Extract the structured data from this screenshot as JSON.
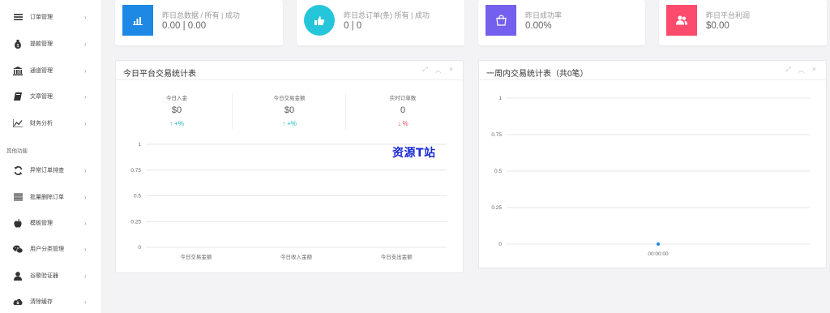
{
  "sidebar": {
    "items": [
      {
        "label": "订单管理",
        "icon": "list-icon"
      },
      {
        "label": "提款管理",
        "icon": "money-bag-icon"
      },
      {
        "label": "通道管理",
        "icon": "bank-icon"
      },
      {
        "label": "文章管理",
        "icon": "book-icon"
      },
      {
        "label": "财务分析",
        "icon": "line-chart-icon"
      }
    ],
    "section_label": "其他功能",
    "other_items": [
      {
        "label": "异常订单排查",
        "icon": "refresh-icon"
      },
      {
        "label": "批量删除订单",
        "icon": "list-icon"
      },
      {
        "label": "模板管理",
        "icon": "apple-icon"
      },
      {
        "label": "用户分类管理",
        "icon": "wechat-icon"
      },
      {
        "label": "谷歌验证器",
        "icon": "user-icon"
      },
      {
        "label": "清除缓存",
        "icon": "cloud-download-icon"
      }
    ],
    "chevron": "›"
  },
  "stats": [
    {
      "label": "昨日总数据 / 所有 | 成功",
      "value": "0.00 | 0.00",
      "color": "#1e88e5",
      "icon": "bar-chart-icon"
    },
    {
      "label": "昨日总订单(条) 所有 | 成功",
      "value": "0  | 0",
      "color": "#26c6da",
      "icon": "thumbs-up-icon"
    },
    {
      "label": "昨日成功率",
      "value": "0.00%",
      "color": "#7460ee",
      "icon": "shopping-bag-icon"
    },
    {
      "label": "昨日平台利润",
      "value": "$0.00",
      "color": "#fc4b6c",
      "icon": "users-icon"
    }
  ],
  "panel_today": {
    "title": "今日平台交易统计表",
    "metrics": [
      {
        "label": "今日入金",
        "value": "$0",
        "arrow": "↑",
        "change": "+%",
        "direction": "up"
      },
      {
        "label": "今日交易金额",
        "value": "$0",
        "arrow": "↑",
        "change": "+%",
        "direction": "up"
      },
      {
        "label": "实时订单数",
        "value": "0",
        "arrow": "↓",
        "change": "%",
        "direction": "down"
      }
    ],
    "watermark": "资源T站"
  },
  "panel_week": {
    "title": "一周内交易统计表（共0笔）"
  },
  "tools": {
    "expand": "⤢",
    "collapse": "︿",
    "close": "×"
  },
  "chart_data": [
    {
      "type": "bar",
      "categories": [
        "今日交易金额",
        "今日收入金额",
        "今日支出金额"
      ],
      "values": [
        0,
        0,
        0
      ],
      "ylim": [
        0,
        1
      ],
      "yticks": [
        "1",
        "0.75",
        "0.5",
        "0.25",
        "0"
      ],
      "grid": true
    },
    {
      "type": "line",
      "x": [
        "00:00:00"
      ],
      "values": [
        0
      ],
      "ylim": [
        0,
        1
      ],
      "yticks": [
        "1",
        "0.75",
        "0.5",
        "0.25",
        "0"
      ],
      "grid": true,
      "point_color": "#1e88e5"
    }
  ]
}
